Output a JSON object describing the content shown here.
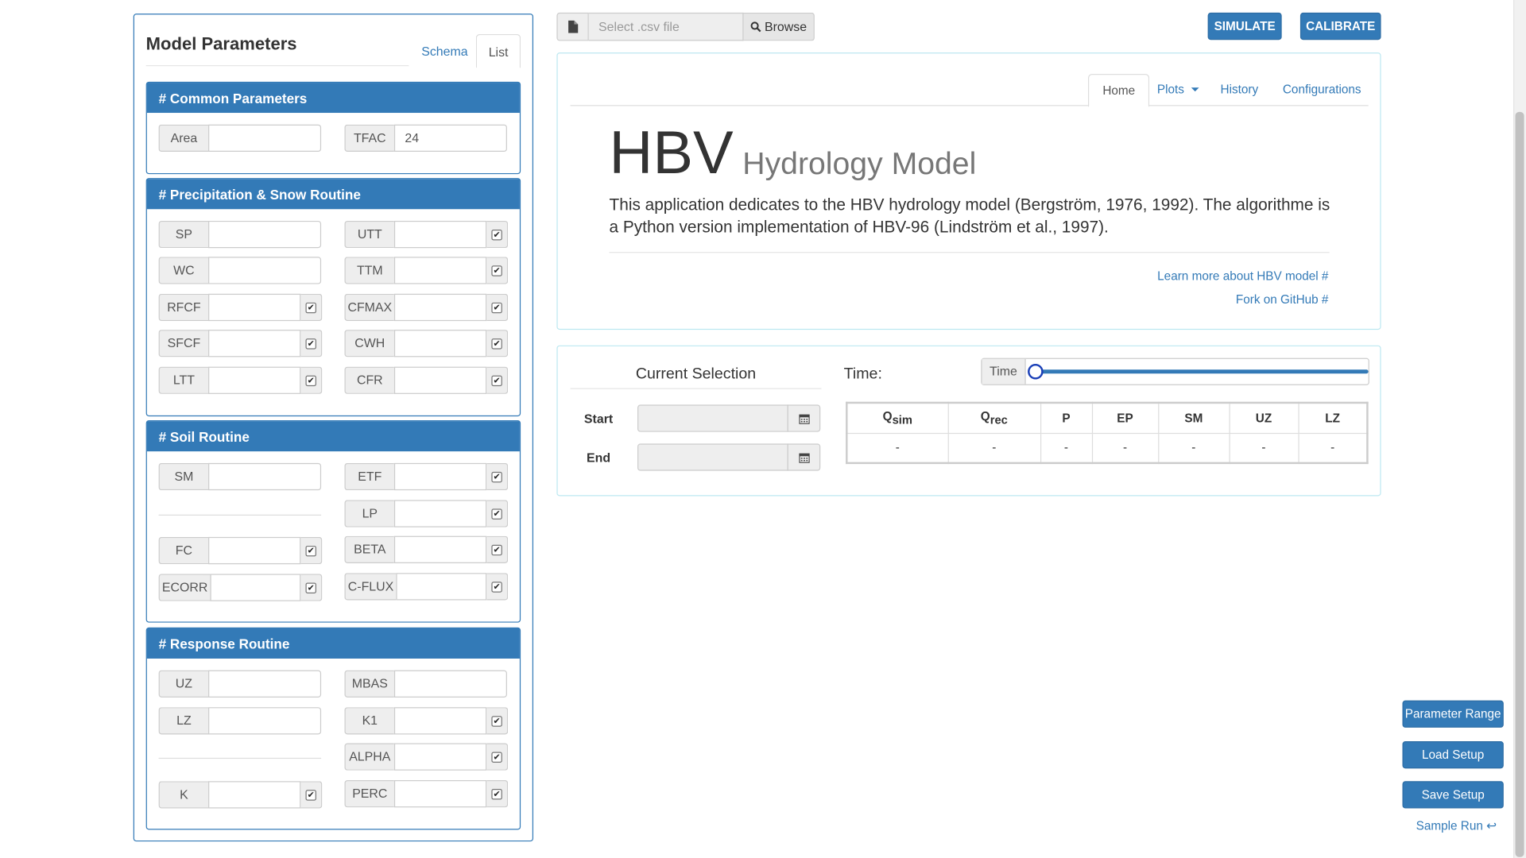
{
  "left_panel": {
    "title": "Model Parameters",
    "tabs": [
      "Schema",
      "List"
    ],
    "sections": {
      "common": {
        "title": "# Common Parameters",
        "fields": [
          {
            "label": "Area",
            "value": ""
          },
          {
            "label": "TFAC",
            "value": "24"
          }
        ]
      },
      "precip": {
        "title": "# Precipitation & Snow Routine",
        "fields": [
          "SP",
          "UTT",
          "WC",
          "TTM",
          "RFCF",
          "CFMAX",
          "SFCF",
          "CWH",
          "LTT",
          "CFR"
        ]
      },
      "soil": {
        "title": "# Soil Routine",
        "fields": [
          "SM",
          "ETF",
          "LP",
          "FC",
          "BETA",
          "ECORR",
          "C-FLUX"
        ]
      },
      "response": {
        "title": "# Response Routine",
        "fields": [
          "UZ",
          "MBAS",
          "LZ",
          "K1",
          "ALPHA",
          "K",
          "PERC"
        ]
      }
    }
  },
  "toolbar": {
    "file_placeholder": "Select .csv file",
    "browse_label": "Browse",
    "simulate_label": "SIMULATE",
    "calibrate_label": "CALIBRATE"
  },
  "home": {
    "tabs": [
      "Home",
      "Plots",
      "History",
      "Configurations"
    ],
    "title": "HBV",
    "subtitle": "Hydrology Model",
    "description": "This application dedicates to the HBV hydrology model (Bergström, 1976, 1992). The algorithme is a Python version implementation of HBV-96 (Lindström et al., 1997).",
    "links": [
      "Learn more about HBV model #",
      "Fork on GitHub #"
    ]
  },
  "selection": {
    "title": "Current Selection",
    "start_label": "Start",
    "end_label": "End",
    "time_label": "Time:",
    "time_addon": "Time",
    "time_position": 0,
    "table": {
      "headers": [
        {
          "main": "Q",
          "sub": "sim"
        },
        {
          "main": "Q",
          "sub": "rec"
        },
        {
          "main": "P"
        },
        {
          "main": "EP"
        },
        {
          "main": "SM"
        },
        {
          "main": "UZ"
        },
        {
          "main": "LZ"
        }
      ],
      "values": [
        "-",
        "-",
        "-",
        "-",
        "-",
        "-",
        "-"
      ]
    }
  },
  "side_buttons": [
    "Parameter Range",
    "Load Setup",
    "Save Setup"
  ],
  "sample_run": "Sample Run ↩",
  "colors": {
    "primary": "#337ab7",
    "panel_border_info": "#bce8f1"
  }
}
